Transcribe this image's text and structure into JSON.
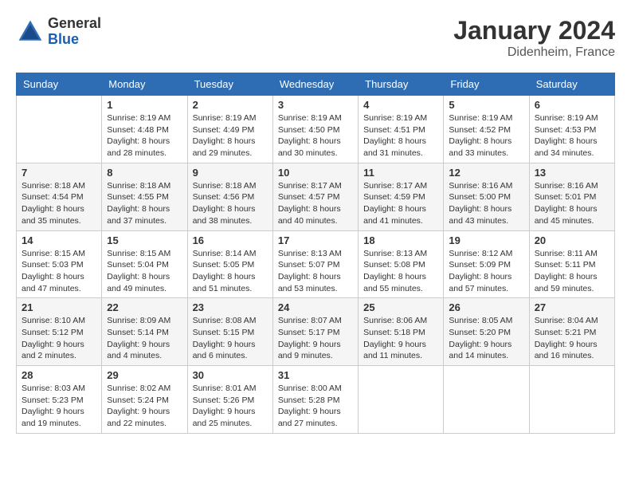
{
  "header": {
    "logo_general": "General",
    "logo_blue": "Blue",
    "month_title": "January 2024",
    "location": "Didenheim, France"
  },
  "days_of_week": [
    "Sunday",
    "Monday",
    "Tuesday",
    "Wednesday",
    "Thursday",
    "Friday",
    "Saturday"
  ],
  "weeks": [
    [
      {
        "day": "",
        "sunrise": "",
        "sunset": "",
        "daylight": ""
      },
      {
        "day": "1",
        "sunrise": "Sunrise: 8:19 AM",
        "sunset": "Sunset: 4:48 PM",
        "daylight": "Daylight: 8 hours and 28 minutes."
      },
      {
        "day": "2",
        "sunrise": "Sunrise: 8:19 AM",
        "sunset": "Sunset: 4:49 PM",
        "daylight": "Daylight: 8 hours and 29 minutes."
      },
      {
        "day": "3",
        "sunrise": "Sunrise: 8:19 AM",
        "sunset": "Sunset: 4:50 PM",
        "daylight": "Daylight: 8 hours and 30 minutes."
      },
      {
        "day": "4",
        "sunrise": "Sunrise: 8:19 AM",
        "sunset": "Sunset: 4:51 PM",
        "daylight": "Daylight: 8 hours and 31 minutes."
      },
      {
        "day": "5",
        "sunrise": "Sunrise: 8:19 AM",
        "sunset": "Sunset: 4:52 PM",
        "daylight": "Daylight: 8 hours and 33 minutes."
      },
      {
        "day": "6",
        "sunrise": "Sunrise: 8:19 AM",
        "sunset": "Sunset: 4:53 PM",
        "daylight": "Daylight: 8 hours and 34 minutes."
      }
    ],
    [
      {
        "day": "7",
        "sunrise": "Sunrise: 8:18 AM",
        "sunset": "Sunset: 4:54 PM",
        "daylight": "Daylight: 8 hours and 35 minutes."
      },
      {
        "day": "8",
        "sunrise": "Sunrise: 8:18 AM",
        "sunset": "Sunset: 4:55 PM",
        "daylight": "Daylight: 8 hours and 37 minutes."
      },
      {
        "day": "9",
        "sunrise": "Sunrise: 8:18 AM",
        "sunset": "Sunset: 4:56 PM",
        "daylight": "Daylight: 8 hours and 38 minutes."
      },
      {
        "day": "10",
        "sunrise": "Sunrise: 8:17 AM",
        "sunset": "Sunset: 4:57 PM",
        "daylight": "Daylight: 8 hours and 40 minutes."
      },
      {
        "day": "11",
        "sunrise": "Sunrise: 8:17 AM",
        "sunset": "Sunset: 4:59 PM",
        "daylight": "Daylight: 8 hours and 41 minutes."
      },
      {
        "day": "12",
        "sunrise": "Sunrise: 8:16 AM",
        "sunset": "Sunset: 5:00 PM",
        "daylight": "Daylight: 8 hours and 43 minutes."
      },
      {
        "day": "13",
        "sunrise": "Sunrise: 8:16 AM",
        "sunset": "Sunset: 5:01 PM",
        "daylight": "Daylight: 8 hours and 45 minutes."
      }
    ],
    [
      {
        "day": "14",
        "sunrise": "Sunrise: 8:15 AM",
        "sunset": "Sunset: 5:03 PM",
        "daylight": "Daylight: 8 hours and 47 minutes."
      },
      {
        "day": "15",
        "sunrise": "Sunrise: 8:15 AM",
        "sunset": "Sunset: 5:04 PM",
        "daylight": "Daylight: 8 hours and 49 minutes."
      },
      {
        "day": "16",
        "sunrise": "Sunrise: 8:14 AM",
        "sunset": "Sunset: 5:05 PM",
        "daylight": "Daylight: 8 hours and 51 minutes."
      },
      {
        "day": "17",
        "sunrise": "Sunrise: 8:13 AM",
        "sunset": "Sunset: 5:07 PM",
        "daylight": "Daylight: 8 hours and 53 minutes."
      },
      {
        "day": "18",
        "sunrise": "Sunrise: 8:13 AM",
        "sunset": "Sunset: 5:08 PM",
        "daylight": "Daylight: 8 hours and 55 minutes."
      },
      {
        "day": "19",
        "sunrise": "Sunrise: 8:12 AM",
        "sunset": "Sunset: 5:09 PM",
        "daylight": "Daylight: 8 hours and 57 minutes."
      },
      {
        "day": "20",
        "sunrise": "Sunrise: 8:11 AM",
        "sunset": "Sunset: 5:11 PM",
        "daylight": "Daylight: 8 hours and 59 minutes."
      }
    ],
    [
      {
        "day": "21",
        "sunrise": "Sunrise: 8:10 AM",
        "sunset": "Sunset: 5:12 PM",
        "daylight": "Daylight: 9 hours and 2 minutes."
      },
      {
        "day": "22",
        "sunrise": "Sunrise: 8:09 AM",
        "sunset": "Sunset: 5:14 PM",
        "daylight": "Daylight: 9 hours and 4 minutes."
      },
      {
        "day": "23",
        "sunrise": "Sunrise: 8:08 AM",
        "sunset": "Sunset: 5:15 PM",
        "daylight": "Daylight: 9 hours and 6 minutes."
      },
      {
        "day": "24",
        "sunrise": "Sunrise: 8:07 AM",
        "sunset": "Sunset: 5:17 PM",
        "daylight": "Daylight: 9 hours and 9 minutes."
      },
      {
        "day": "25",
        "sunrise": "Sunrise: 8:06 AM",
        "sunset": "Sunset: 5:18 PM",
        "daylight": "Daylight: 9 hours and 11 minutes."
      },
      {
        "day": "26",
        "sunrise": "Sunrise: 8:05 AM",
        "sunset": "Sunset: 5:20 PM",
        "daylight": "Daylight: 9 hours and 14 minutes."
      },
      {
        "day": "27",
        "sunrise": "Sunrise: 8:04 AM",
        "sunset": "Sunset: 5:21 PM",
        "daylight": "Daylight: 9 hours and 16 minutes."
      }
    ],
    [
      {
        "day": "28",
        "sunrise": "Sunrise: 8:03 AM",
        "sunset": "Sunset: 5:23 PM",
        "daylight": "Daylight: 9 hours and 19 minutes."
      },
      {
        "day": "29",
        "sunrise": "Sunrise: 8:02 AM",
        "sunset": "Sunset: 5:24 PM",
        "daylight": "Daylight: 9 hours and 22 minutes."
      },
      {
        "day": "30",
        "sunrise": "Sunrise: 8:01 AM",
        "sunset": "Sunset: 5:26 PM",
        "daylight": "Daylight: 9 hours and 25 minutes."
      },
      {
        "day": "31",
        "sunrise": "Sunrise: 8:00 AM",
        "sunset": "Sunset: 5:28 PM",
        "daylight": "Daylight: 9 hours and 27 minutes."
      },
      {
        "day": "",
        "sunrise": "",
        "sunset": "",
        "daylight": ""
      },
      {
        "day": "",
        "sunrise": "",
        "sunset": "",
        "daylight": ""
      },
      {
        "day": "",
        "sunrise": "",
        "sunset": "",
        "daylight": ""
      }
    ]
  ]
}
